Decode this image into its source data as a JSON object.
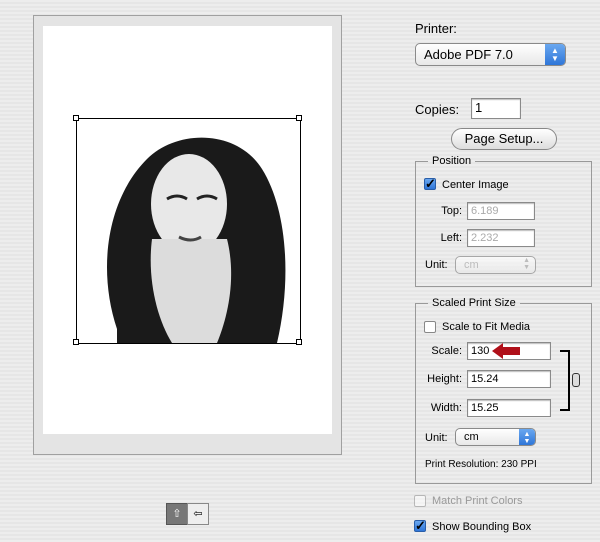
{
  "printer": {
    "label": "Printer:",
    "value": "Adobe PDF 7.0"
  },
  "copies": {
    "label": "Copies:",
    "value": "1"
  },
  "page_setup_label": "Page Setup...",
  "position": {
    "title": "Position",
    "center_image": {
      "label": "Center Image",
      "checked": true
    },
    "top": {
      "label": "Top:",
      "value": "6.189"
    },
    "left": {
      "label": "Left:",
      "value": "2.232"
    },
    "unit": {
      "label": "Unit:",
      "value": "cm"
    }
  },
  "scaled": {
    "title": "Scaled Print Size",
    "scale_to_fit": {
      "label": "Scale to Fit Media",
      "checked": false
    },
    "scale": {
      "label": "Scale:",
      "value": "130"
    },
    "height": {
      "label": "Height:",
      "value": "15.24"
    },
    "width": {
      "label": "Width:",
      "value": "15.25"
    },
    "unit": {
      "label": "Unit:",
      "value": "cm"
    },
    "resolution": "Print Resolution: 230 PPI"
  },
  "match_print_colors": {
    "label": "Match Print Colors",
    "checked": false
  },
  "show_bounding_box": {
    "label": "Show Bounding Box",
    "checked": true
  },
  "colors": {
    "arrow": "#b0101a",
    "accent": "#2f76d8"
  }
}
